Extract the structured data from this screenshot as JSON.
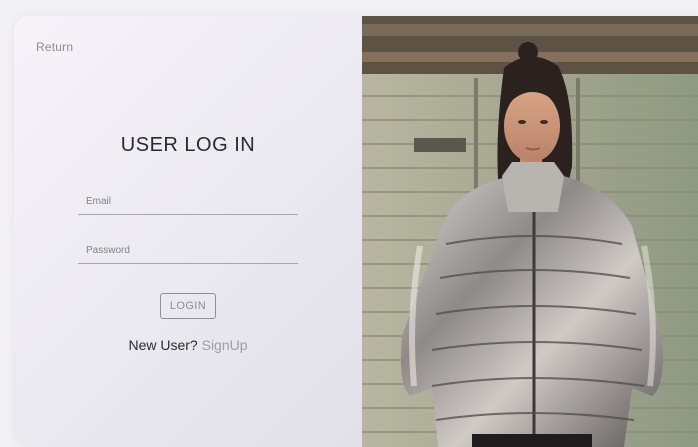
{
  "nav": {
    "return_label": "Return"
  },
  "form": {
    "title": "USER LOG IN",
    "email_placeholder": "Email",
    "password_placeholder": "Password",
    "login_label": "LOGIN",
    "new_user_text": "New User?",
    "signup_label": "SignUp"
  },
  "colors": {
    "background": "#f2f1f4",
    "panel_gradient_start": "#f6f4f9",
    "panel_gradient_end": "#e2e0e8",
    "text_dark": "#2a2a33",
    "text_muted": "#8b8b95"
  }
}
